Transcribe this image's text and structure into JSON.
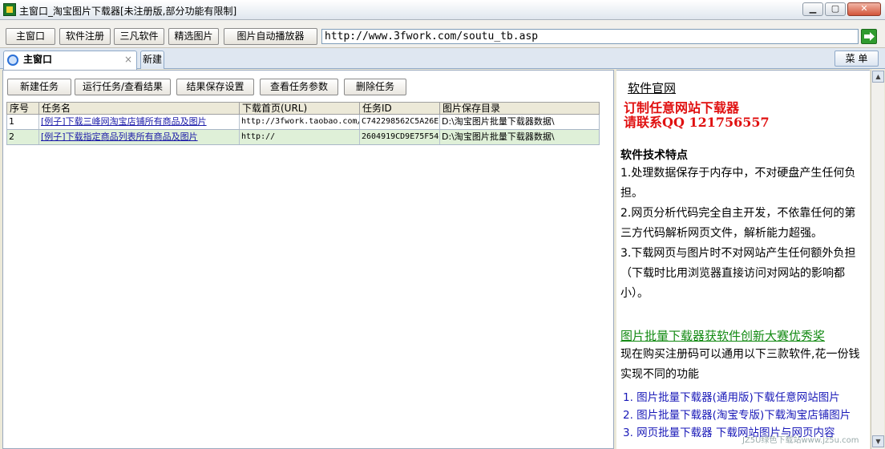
{
  "window": {
    "title": "主窗口_淘宝图片下载器[未注册版,部分功能有限制]",
    "icon": "app-logo-icon"
  },
  "toolbar": {
    "buttons": [
      "主窗口",
      "软件注册",
      "三凡软件",
      "精选图片",
      "图片自动播放器"
    ],
    "url": "http://www.3fwork.com/soutu_tb.asp",
    "go_icon": "arrow-right-icon"
  },
  "tabs": {
    "items": [
      "主窗口",
      "新建"
    ],
    "menu_label": "菜 单"
  },
  "actions": [
    "新建任务",
    "运行任务/查看结果",
    "结果保存设置",
    "查看任务参数",
    "删除任务"
  ],
  "table": {
    "headers": [
      "序号",
      "任务名",
      "下载首页(URL)",
      "任务ID",
      "图片保存目录"
    ],
    "rows": [
      [
        "1",
        "[例子]下载三峰网淘宝店铺所有商品及图片",
        "http://3fwork.taobao.com/",
        "C742298562C5A26E",
        "D:\\淘宝图片批量下载器数据\\"
      ],
      [
        "2",
        "[例子]下载指定商品列表所有商品及图片",
        "http://",
        "2604919CD9E75F54",
        "D:\\淘宝图片批量下载器数据\\"
      ]
    ]
  },
  "info": {
    "official_link": "软件官网",
    "promo_line1": "订制任意网站下载器",
    "promo_line2": "请联系QQ 121756557",
    "features_title": "软件技术特点",
    "features_p1": "1.处理数据保存于内存中，不对硬盘产生任何负担。",
    "features_p2": "2.网页分析代码完全自主开发，不依靠任何的第三方代码解析网页文件，解析能力超强。",
    "features_p3": "3.下载网页与图片时不对网站产生任何额外负担（下载时比用浏览器直接访问对网站的影响都小）。",
    "award": "图片批量下载器获软件创新大赛优秀奖",
    "bundle_text": "现在购买注册码可以通用以下三款软件,花一份钱实现不同的功能",
    "bundle_items": [
      "1. 图片批量下载器(通用版)下载任意网站图片",
      "2. 图片批量下载器(淘宝专版)下载淘宝店铺图片",
      "3. 网页批量下载器 下载网站图片与网页内容"
    ]
  },
  "watermark": "JZ5U绿色下载站www.jz5u.com",
  "colors": {
    "promo_red": "#e01010",
    "award_green": "#138a13",
    "link_blue": "#1a1ab8",
    "row_alt": "#dff0d8"
  }
}
